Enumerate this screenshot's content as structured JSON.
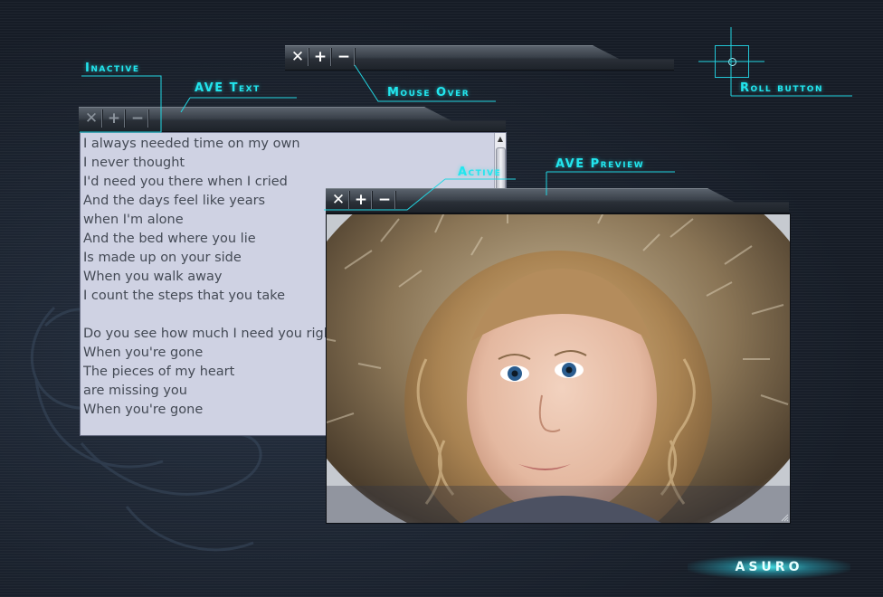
{
  "title_buttons": {
    "close": "✕",
    "maximize": "+",
    "minimize": "−"
  },
  "callouts": {
    "inactive": "Inactive",
    "ave_text": "AVE Text",
    "mouse_over": "Mouse Over",
    "roll_button": "Roll button",
    "active": "Active",
    "ave_preview": "AVE Preview"
  },
  "text_window": {
    "lines": [
      "I always needed time on my own",
      "I never thought",
      "I'd need you there when I cried",
      "And the days feel like years",
      "when I'm alone",
      "And the bed where you lie",
      "Is made up on your side",
      "When you walk away",
      "I count the steps that you take",
      "",
      "Do you see how much I need you right now",
      "When you're gone",
      "The pieces of my heart",
      "are missing you",
      "When you're gone"
    ]
  },
  "brand": {
    "label": "ASURO"
  },
  "colors": {
    "accent": "#22e6ee",
    "text_bg": "#cfd2e3",
    "background": "#1c2430"
  },
  "icons": {
    "close": "close-icon",
    "maximize": "plus-icon",
    "minimize": "minus-icon",
    "roll": "roll-icon"
  }
}
